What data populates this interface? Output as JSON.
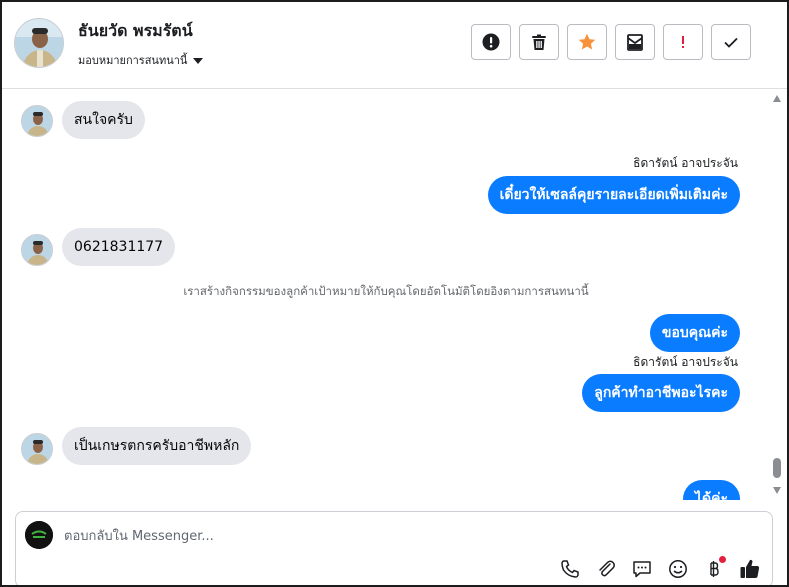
{
  "header": {
    "name": "ธันยวัด พรมรัตน์",
    "subtitle": "มอบหมายการสนทนานี้"
  },
  "actions": [
    {
      "icon": "alert-circle-icon",
      "label": "Spam"
    },
    {
      "icon": "trash-icon",
      "label": "Delete"
    },
    {
      "icon": "star-icon",
      "label": "Follow up"
    },
    {
      "icon": "mark-unread-icon",
      "label": "Mark unread"
    },
    {
      "icon": "exclamation-icon",
      "label": "Priority"
    },
    {
      "icon": "checkmark-icon",
      "label": "Done"
    }
  ],
  "messages": {
    "m1": "สนใจครับ",
    "sender1": "ธิดารัตน์ อาจประจัน",
    "m2": "เดี๋ยวให้เซลล์คุยรายละเอียดเพิ่มเติมค่ะ",
    "m3": "0621831177",
    "system": "เราสร้างกิจกรรมของลูกค้าเป้าหมายให้กับคุณโดยอัตโนมัติโดยอิงตามการสนทนานี้",
    "m4": "ขอบคุณค่ะ",
    "sender2": "ธิดารัตน์ อาจประจัน",
    "m5": "ลูกค้าทำอาชีพอะไรคะ",
    "m6": "เป็นเกษรตกรครับอาชีพหลัก",
    "m7": "ได้ค่ะ"
  },
  "composer": {
    "placeholder": "ตอบกลับใน Messenger..."
  },
  "colors": {
    "outgoing_bubble": "#0a7cff",
    "incoming_bubble": "#e4e6eb",
    "star": "#f7923b",
    "alert": "#e41e3f"
  }
}
